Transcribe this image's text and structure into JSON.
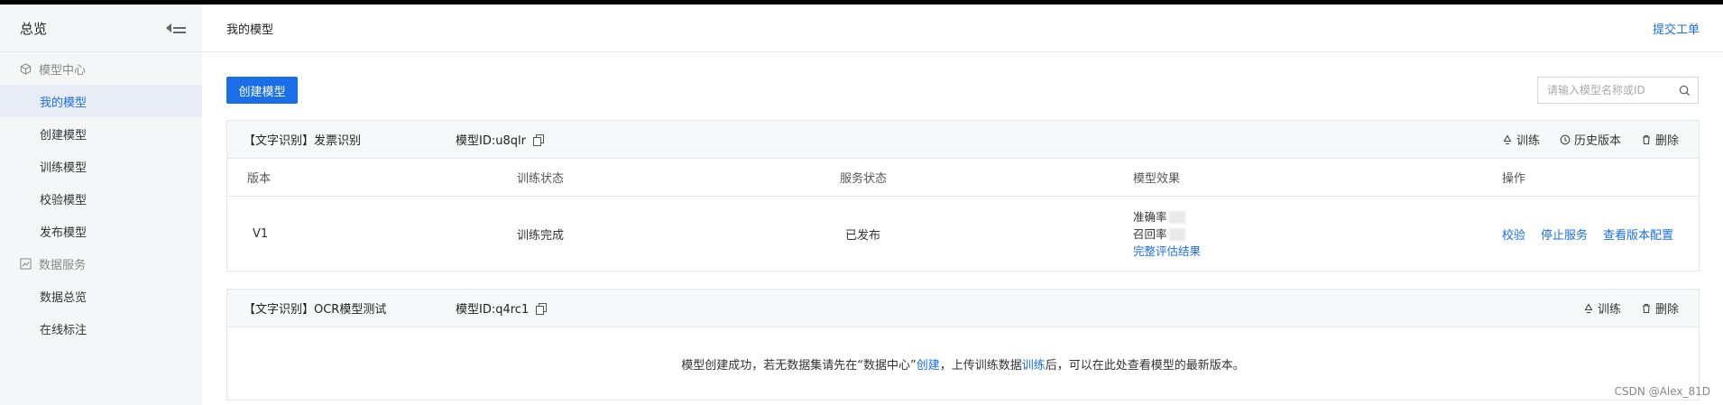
{
  "sidebar": {
    "title": "总览",
    "groups": [
      {
        "label": "模型中心",
        "items": [
          "我的模型",
          "创建模型",
          "训练模型",
          "校验模型",
          "发布模型"
        ]
      },
      {
        "label": "数据服务",
        "items": [
          "数据总览",
          "在线标注"
        ]
      }
    ],
    "active_item": "我的模型"
  },
  "header": {
    "title": "我的模型",
    "submit_ticket": "提交工单"
  },
  "toolbar": {
    "create_label": "创建模型",
    "search_placeholder": "请输入模型名称或ID"
  },
  "cards": [
    {
      "name": "【文字识别】发票识别",
      "id": "模型ID:u8qlr",
      "actions": {
        "train": "训练",
        "history": "历史版本",
        "delete": "删除"
      },
      "columns": [
        "版本",
        "训练状态",
        "服务状态",
        "模型效果",
        "操作"
      ],
      "row": {
        "version": "V1",
        "train_status": "训练完成",
        "service_status": "已发布",
        "precision_label": "准确率",
        "recall_label": "召回率",
        "eval_link": "完整评估结果",
        "ops": [
          "校验",
          "停止服务",
          "查看版本配置"
        ]
      }
    },
    {
      "name": "【文字识别】OCR模型测试",
      "id": "模型ID:q4rc1",
      "actions": {
        "train": "训练",
        "delete": "删除"
      },
      "message": {
        "part1": "模型创建成功，若无数据集请先在“数据中心”",
        "link1": "创建",
        "part2": "，上传训练数据",
        "link2": "训练",
        "part3": "后，可以在此处查看模型的最新版本。"
      }
    }
  ],
  "watermark": "CSDN @Alex_81D",
  "colors": {
    "accent": "#1a6fe8",
    "sidebar_bg": "#f5f6f8",
    "card_head_bg": "#f7f8fa"
  }
}
